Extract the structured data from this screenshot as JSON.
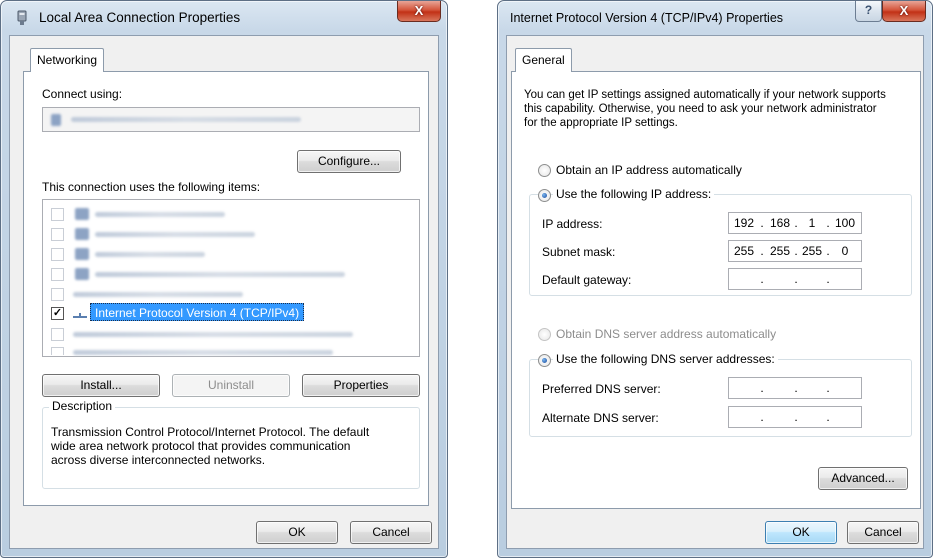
{
  "left_dialog": {
    "title": "Local Area Connection Properties",
    "close_label": "X",
    "tab": "Networking",
    "connect_using_label": "Connect using:",
    "configure_button": "Configure...",
    "items_label": "This connection uses the following items:",
    "selected_item": "Internet Protocol Version 4 (TCP/IPv4)",
    "install_button": "Install...",
    "uninstall_button": "Uninstall",
    "properties_button": "Properties",
    "description_label": "Description",
    "description_lines": [
      "Transmission Control Protocol/Internet Protocol. The default",
      "wide area network protocol that provides communication",
      "across diverse interconnected networks."
    ],
    "ok_button": "OK",
    "cancel_button": "Cancel"
  },
  "right_dialog": {
    "title": "Internet Protocol Version 4 (TCP/IPv4) Properties",
    "help_label": "?",
    "close_label": "X",
    "tab": "General",
    "intro_lines": [
      "You can get IP settings assigned automatically if your network supports",
      "this capability. Otherwise, you need to ask your network administrator",
      "for the appropriate IP settings."
    ],
    "obtain_ip_auto": "Obtain an IP address automatically",
    "use_following_ip": "Use the following IP address:",
    "ip_address_label": "IP address:",
    "ip_address": [
      "192",
      "168",
      "1",
      "100"
    ],
    "subnet_mask_label": "Subnet mask:",
    "subnet_mask": [
      "255",
      "255",
      "255",
      "0"
    ],
    "default_gateway_label": "Default gateway:",
    "obtain_dns_auto": "Obtain DNS server address automatically",
    "use_following_dns": "Use the following DNS server addresses:",
    "preferred_dns_label": "Preferred DNS server:",
    "alternate_dns_label": "Alternate DNS server:",
    "advanced_button": "Advanced...",
    "ok_button": "OK",
    "cancel_button": "Cancel"
  }
}
